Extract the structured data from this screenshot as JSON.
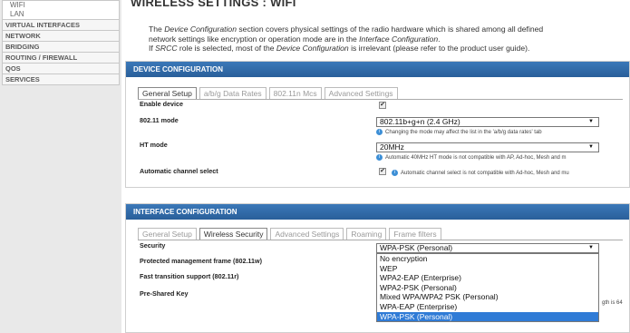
{
  "sidebar": {
    "sub_items": [
      "WIFI",
      "LAN"
    ],
    "items": [
      "VIRTUAL INTERFACES",
      "NETWORK",
      "BRIDGING",
      "ROUTING / FIREWALL",
      "QOS",
      "SERVICES"
    ]
  },
  "page": {
    "title": "WIRELESS SETTINGS : WIFI",
    "intro_1a": "The ",
    "intro_1b": "Device Configuration",
    "intro_1c": " section covers physical settings of the radio hardware which is shared among all defined",
    "intro_2a": "network settings like encryption or operation mode are in the ",
    "intro_2b": "Interface Configuration",
    "intro_2c": ".",
    "intro_3a": "If ",
    "intro_3b": "SRCC",
    "intro_3c": " role is selected, most of the ",
    "intro_3d": "Device Configuration",
    "intro_3e": " is irrelevant (please refer to the product user guide)."
  },
  "device": {
    "header": "DEVICE CONFIGURATION",
    "tabs": [
      "General Setup",
      "a/b/g Data Rates",
      "802.11n Mcs",
      "Advanced Settings"
    ],
    "enable_label": "Enable device",
    "mode_label": "802.11 mode",
    "mode_value": "802.11b+g+n (2.4 GHz)",
    "mode_hint": "Changing the mode may affect the list in the 'a/b/g data rates' tab",
    "ht_label": "HT mode",
    "ht_value": "20MHz",
    "ht_hint": "Automatic 40MHz HT mode is not compatible with AP, Ad-hoc, Mesh and m",
    "auto_label": "Automatic channel select",
    "auto_hint": "Automatic channel select is not compatible with Ad-hoc, Mesh and mu"
  },
  "iface": {
    "header": "INTERFACE CONFIGURATION",
    "tabs": [
      "General Setup",
      "Wireless Security",
      "Advanced Settings",
      "Roaming",
      "Frame filters"
    ],
    "security_label": "Security",
    "security_value": "WPA-PSK (Personal)",
    "pmf_label": "Protected management frame (802.11w)",
    "ft_label": "Fast transition support (802.11r)",
    "psk_label": "Pre-Shared Key",
    "psk_hint": "gth is 64",
    "options": [
      "No encryption",
      "WEP",
      "WPA2-EAP (Enterprise)",
      "WPA2-PSK (Personal)",
      "Mixed WPA/WPA2 PSK (Personal)",
      "WPA-EAP (Enterprise)",
      "WPA-PSK (Personal)"
    ],
    "selected_index": 6
  },
  "colors": {
    "accent": "#2f6aa8",
    "highlight": "#2f7bd6"
  }
}
